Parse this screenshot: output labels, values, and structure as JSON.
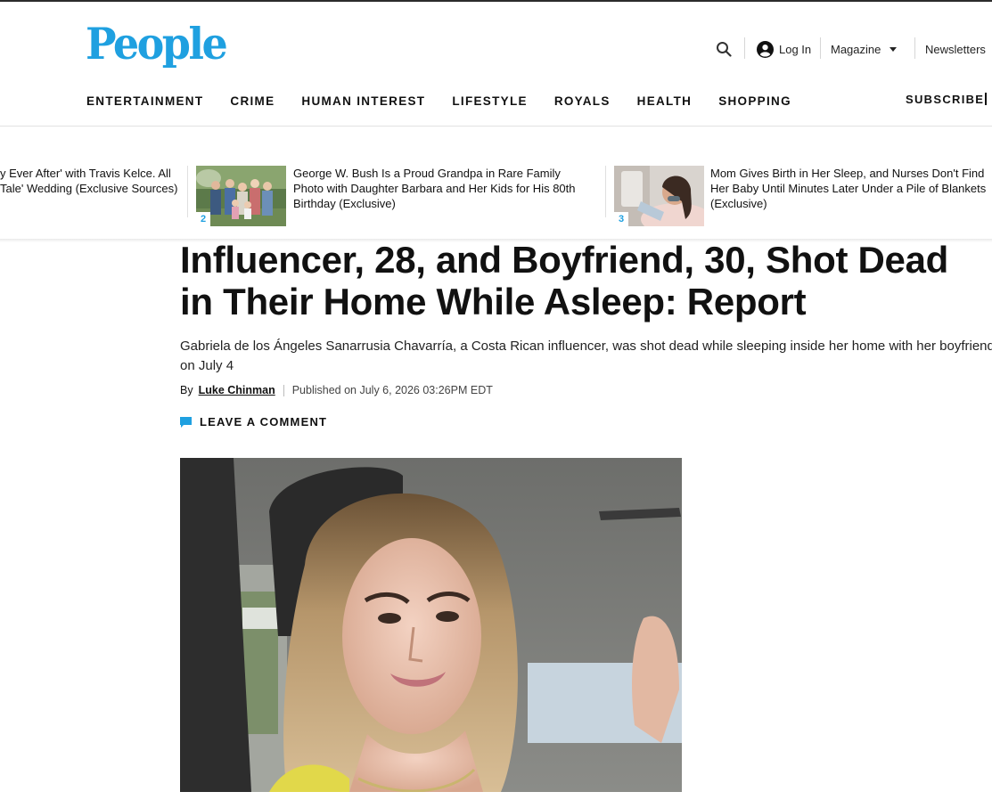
{
  "brand": {
    "logo_text": "People",
    "color": "#1fa0e0"
  },
  "header": {
    "search_icon": "search-icon",
    "login_label": "Log In",
    "magazine_label": "Magazine",
    "newsletters_label": "Newsletters",
    "subscribe_label": "SUBSCRIBE"
  },
  "nav": {
    "items": [
      "ENTERTAINMENT",
      "CRIME",
      "HUMAN INTEREST",
      "LIFESTYLE",
      "ROYALS",
      "HEALTH",
      "SHOPPING"
    ]
  },
  "trending": [
    {
      "number": "",
      "lines": [
        "y Ever After' with Travis Kelce. All",
        "Tale' Wedding (Exclusive Sources)"
      ]
    },
    {
      "number": "2",
      "lines": [
        "George W. Bush Is a Proud Grandpa in Rare Family",
        "Photo with Daughter Barbara and Her Kids for His 80th",
        "Birthday (Exclusive)"
      ]
    },
    {
      "number": "3",
      "lines": [
        "Mom Gives Birth in Her Sleep, and Nurses Don't Find",
        "Her Baby Until Minutes Later Under a Pile of Blankets",
        "(Exclusive)"
      ]
    }
  ],
  "article": {
    "headline_line1": "Influencer, 28, and Boyfriend, 30, Shot Dead",
    "headline_line2": "in Their Home While Asleep: Report",
    "dek_line1": "Gabriela de los Ángeles Sanarrusia Chavarría, a Costa Rican influencer, was shot dead while sleeping inside her home with her boyfriend",
    "dek_line2": "on July 4",
    "by_label": "By",
    "author": "Luke Chinman",
    "published": "Published on July 6, 2026 03:26PM EDT",
    "comment_label": "LEAVE A COMMENT"
  }
}
